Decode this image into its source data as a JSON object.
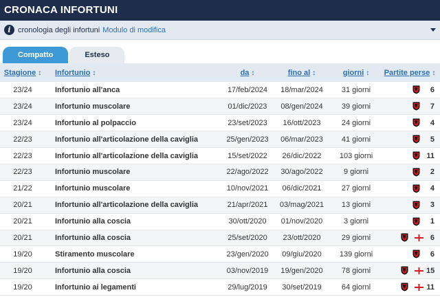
{
  "header": {
    "title": "CRONACA INFORTUNI"
  },
  "subbar": {
    "info_icon": "info-icon",
    "label": "cronologia degli infortuni",
    "link": "Modulo di modifica",
    "caret_icon": "chevron-down-icon"
  },
  "tabs": [
    {
      "label": "Compatto",
      "active": true
    },
    {
      "label": "Esteso",
      "active": false
    }
  ],
  "columns": {
    "stagione": "Stagione",
    "infortunio": "Infortunio",
    "da": "da",
    "fino_al": "fino al",
    "giorni": "giorni",
    "partite_perse": "Partite perse",
    "sort_icon": "↕"
  },
  "colors": {
    "header_bg": "#1d2d4b",
    "tab_active": "#3d9ad6",
    "link": "#2a6fb0",
    "club_red": "#d71920"
  },
  "rows": [
    {
      "season": "23/24",
      "injury": "Infortunio all'anca",
      "from": "17/feb/2024",
      "until": "18/mar/2024",
      "days": "31 giorni",
      "games": "6",
      "flag": false
    },
    {
      "season": "23/24",
      "injury": "Infortunio muscolare",
      "from": "01/dic/2023",
      "until": "08/gen/2024",
      "days": "39 giorni",
      "games": "7",
      "flag": false
    },
    {
      "season": "23/24",
      "injury": "Infortunio al polpaccio",
      "from": "23/set/2023",
      "until": "16/ott/2023",
      "days": "24 giorni",
      "games": "4",
      "flag": false
    },
    {
      "season": "22/23",
      "injury": "Infortunio all'articolazione della caviglia",
      "from": "25/gen/2023",
      "until": "06/mar/2023",
      "days": "41 giorni",
      "games": "5",
      "flag": false
    },
    {
      "season": "22/23",
      "injury": "Infortunio all'articolazione della caviglia",
      "from": "15/set/2022",
      "until": "26/dic/2022",
      "days": "103 giorni",
      "games": "11",
      "flag": false
    },
    {
      "season": "22/23",
      "injury": "Infortunio muscolare",
      "from": "22/ago/2022",
      "until": "30/ago/2022",
      "days": "9 giorni",
      "games": "2",
      "flag": false
    },
    {
      "season": "21/22",
      "injury": "Infortunio muscolare",
      "from": "10/nov/2021",
      "until": "06/dic/2021",
      "days": "27 giorni",
      "games": "4",
      "flag": false
    },
    {
      "season": "20/21",
      "injury": "Infortunio all'articolazione della caviglia",
      "from": "21/apr/2021",
      "until": "03/mag/2021",
      "days": "13 giorni",
      "games": "3",
      "flag": false
    },
    {
      "season": "20/21",
      "injury": "Infortunio alla coscia",
      "from": "30/ott/2020",
      "until": "01/nov/2020",
      "days": "3 giorni",
      "games": "1",
      "flag": false
    },
    {
      "season": "20/21",
      "injury": "Infortunio alla coscia",
      "from": "25/set/2020",
      "until": "23/ott/2020",
      "days": "29 giorni",
      "games": "6",
      "flag": true
    },
    {
      "season": "19/20",
      "injury": "Stiramento muscolare",
      "from": "23/gen/2020",
      "until": "09/giu/2020",
      "days": "139 giorni",
      "games": "6",
      "flag": false
    },
    {
      "season": "19/20",
      "injury": "Infortunio alla coscia",
      "from": "03/nov/2019",
      "until": "19/gen/2020",
      "days": "78 giorni",
      "games": "15",
      "flag": true
    },
    {
      "season": "19/20",
      "injury": "Infortunio ai legamenti",
      "from": "29/lug/2019",
      "until": "30/set/2019",
      "days": "64 giorni",
      "games": "11",
      "flag": true
    }
  ]
}
